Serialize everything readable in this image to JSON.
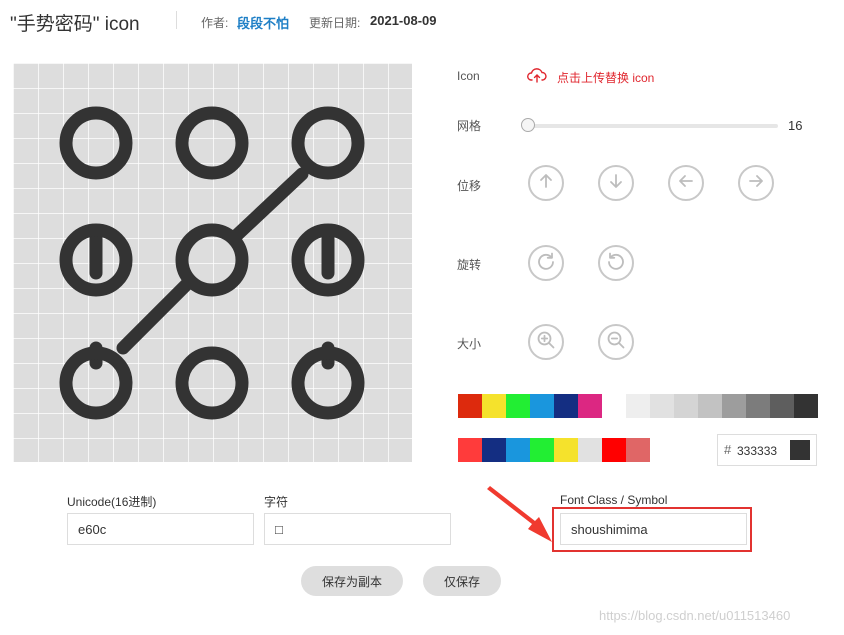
{
  "header": {
    "title": "\"手势密码\" icon",
    "author_label": "作者:",
    "author": "段段不怕",
    "date_label": "更新日期:",
    "date": "2021-08-09"
  },
  "panel": {
    "icon_label": "Icon",
    "upload_text": "点击上传替换 icon",
    "grid_label": "网格",
    "grid_value": "16",
    "move_label": "位移",
    "rotate_label": "旋转",
    "size_label": "大小"
  },
  "icons": {
    "upload": "cloud-upload-icon",
    "move": [
      "arrow-up-icon",
      "arrow-down-icon",
      "arrow-left-icon",
      "arrow-right-icon"
    ],
    "rotate": [
      "rotate-clockwise-icon",
      "rotate-counterclockwise-icon"
    ],
    "size": [
      "zoom-in-icon",
      "zoom-out-icon"
    ]
  },
  "colors": {
    "icon": "#333333",
    "accent_red": "#e0262e",
    "link_blue": "#1e7fc6",
    "palette_row1": [
      "#dd2a0d",
      "#f5e22c",
      "#22ee33",
      "#1a96dd",
      "#142e82",
      "#dc2782",
      "#ffffff",
      "#eeeeee",
      "#e1e1e1",
      "#d4d4d4",
      "#c2c2c2",
      "#9d9d9d",
      "#7c7c7c",
      "#5e5e5e",
      "#333333"
    ],
    "palette_row2": [
      "#ff3b3b",
      "#142e82",
      "#1a96dd",
      "#22ee33",
      "#f5e22c",
      "#e1e1e1",
      "#ff0000",
      "#e06666"
    ]
  },
  "color_picker": {
    "hash": "#",
    "value": "333333"
  },
  "fields": {
    "unicode_label": "Unicode(16进制)",
    "unicode_value": "e60c",
    "char_label": "字符",
    "char_value": "□",
    "fontclass_label": "Font Class / Symbol",
    "fontclass_value": "shoushimima"
  },
  "buttons": {
    "save_copy": "保存为副本",
    "save_only": "仅保存"
  },
  "watermark": "https://blog.csdn.net/u011513460"
}
